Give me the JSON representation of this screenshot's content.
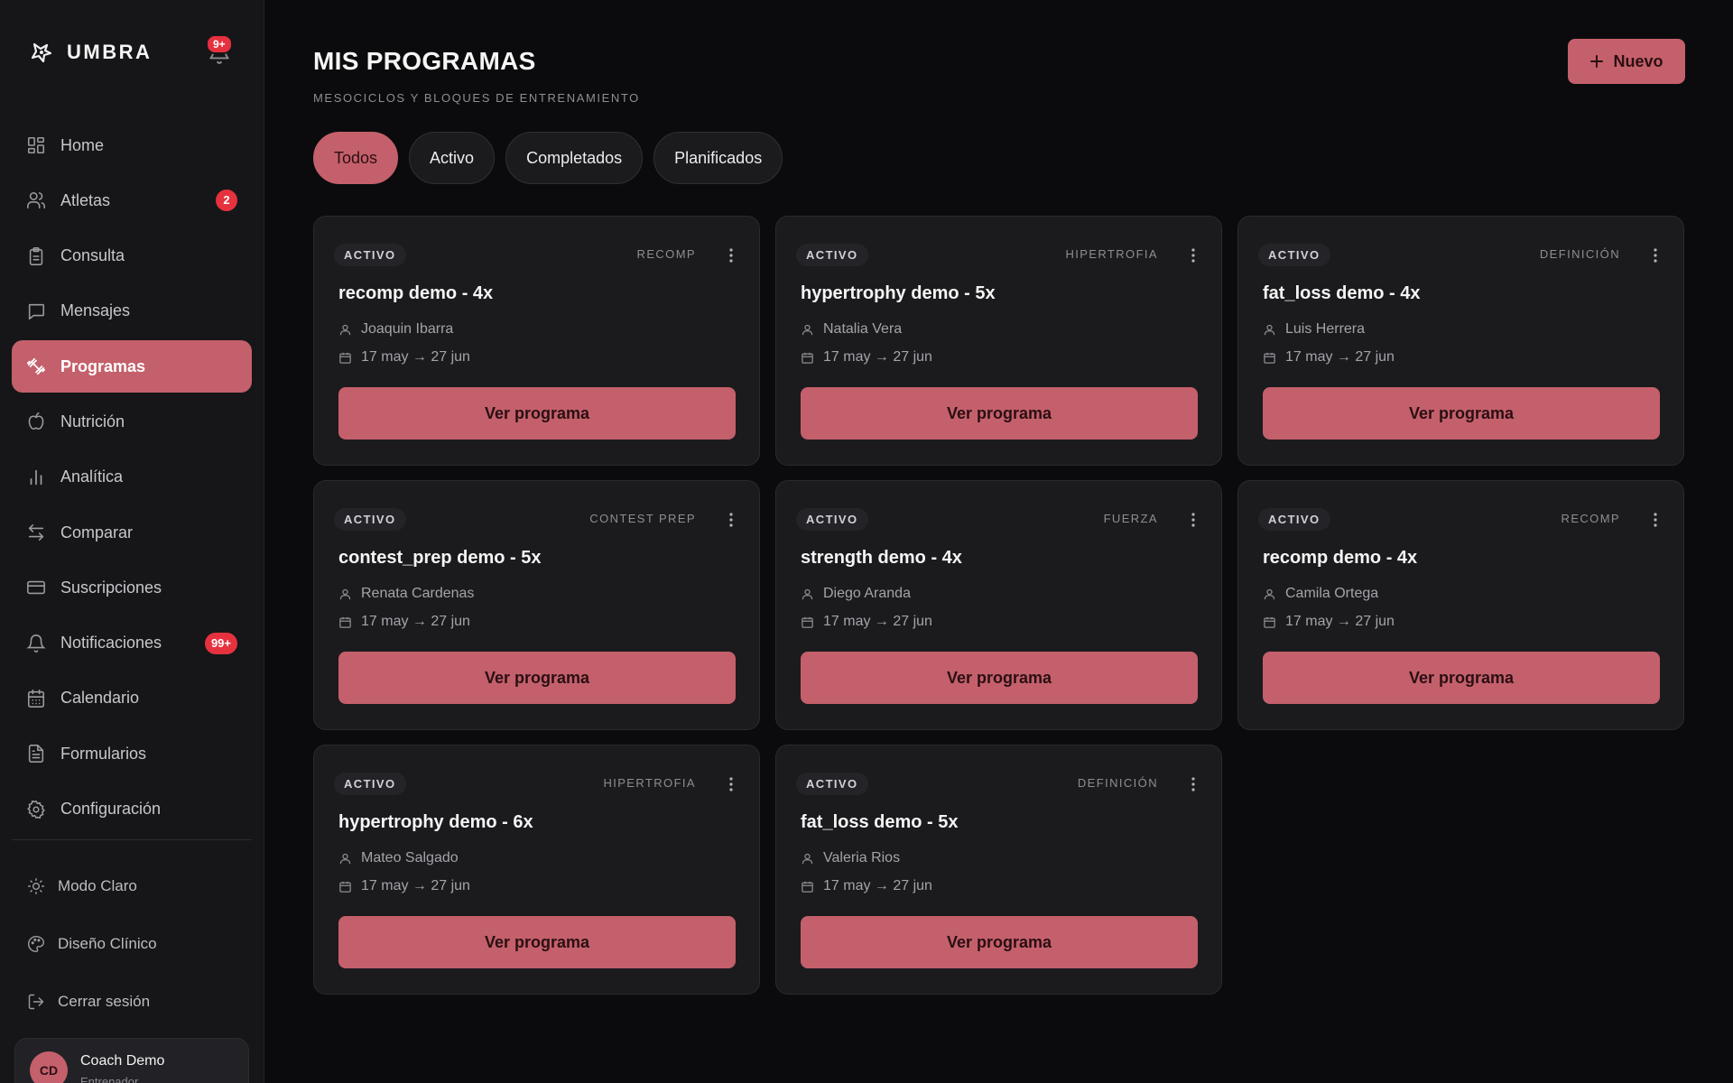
{
  "app": {
    "name": "UMBRA",
    "notifications_badge": "9+"
  },
  "sidebar": {
    "items": [
      {
        "id": "home",
        "label": "Home",
        "icon": "grid-icon",
        "active": false,
        "badge": ""
      },
      {
        "id": "atletas",
        "label": "Atletas",
        "icon": "users-icon",
        "active": false,
        "badge": "2"
      },
      {
        "id": "consulta",
        "label": "Consulta",
        "icon": "clipboard-icon",
        "active": false,
        "badge": ""
      },
      {
        "id": "mensajes",
        "label": "Mensajes",
        "icon": "message-icon",
        "active": false,
        "badge": ""
      },
      {
        "id": "programas",
        "label": "Programas",
        "icon": "dumbbell-icon",
        "active": true,
        "badge": ""
      },
      {
        "id": "nutricion",
        "label": "Nutrición",
        "icon": "apple-icon",
        "active": false,
        "badge": ""
      },
      {
        "id": "analitica",
        "label": "Analítica",
        "icon": "bar-chart-icon",
        "active": false,
        "badge": ""
      },
      {
        "id": "comparar",
        "label": "Comparar",
        "icon": "arrows-swap-icon",
        "active": false,
        "badge": ""
      },
      {
        "id": "suscripciones",
        "label": "Suscripciones",
        "icon": "credit-card-icon",
        "active": false,
        "badge": ""
      },
      {
        "id": "notificaciones",
        "label": "Notificaciones",
        "icon": "bell-icon",
        "active": false,
        "badge": "99+"
      },
      {
        "id": "calendario",
        "label": "Calendario",
        "icon": "calendar-icon",
        "active": false,
        "badge": ""
      },
      {
        "id": "formularios",
        "label": "Formularios",
        "icon": "file-text-icon",
        "active": false,
        "badge": ""
      },
      {
        "id": "configuracion",
        "label": "Configuración",
        "icon": "gear-icon",
        "active": false,
        "badge": ""
      }
    ],
    "bottom": {
      "theme": "Modo Claro",
      "design": "Diseño Clínico",
      "logout": "Cerrar sesión"
    },
    "profile": {
      "initials": "CD",
      "name": "Coach Demo",
      "role": "Entrenador"
    }
  },
  "header": {
    "title": "MIS PROGRAMAS",
    "subtitle": "MESOCICLOS Y BLOQUES DE ENTRENAMIENTO",
    "new_button": "Nuevo"
  },
  "tabs": [
    {
      "label": "Todos",
      "active": true
    },
    {
      "label": "Activo",
      "active": false
    },
    {
      "label": "Completados",
      "active": false
    },
    {
      "label": "Planificados",
      "active": false
    }
  ],
  "programs": [
    {
      "status": "ACTIVO",
      "category": "RECOMP",
      "title": "recomp demo - 4x",
      "athlete": "Joaquin Ibarra",
      "dates": "17 may → 27 jun",
      "button": "Ver programa"
    },
    {
      "status": "ACTIVO",
      "category": "HIPERTROFIA",
      "title": "hypertrophy demo - 5x",
      "athlete": "Natalia Vera",
      "dates": "17 may → 27 jun",
      "button": "Ver programa"
    },
    {
      "status": "ACTIVO",
      "category": "DEFINICIÓN",
      "title": "fat_loss demo - 4x",
      "athlete": "Luis Herrera",
      "dates": "17 may → 27 jun",
      "button": "Ver programa"
    },
    {
      "status": "ACTIVO",
      "category": "CONTEST PREP",
      "title": "contest_prep demo - 5x",
      "athlete": "Renata Cardenas",
      "dates": "17 may → 27 jun",
      "button": "Ver programa"
    },
    {
      "status": "ACTIVO",
      "category": "FUERZA",
      "title": "strength demo - 4x",
      "athlete": "Diego Aranda",
      "dates": "17 may → 27 jun",
      "button": "Ver programa"
    },
    {
      "status": "ACTIVO",
      "category": "RECOMP",
      "title": "recomp demo - 4x",
      "athlete": "Camila Ortega",
      "dates": "17 may → 27 jun",
      "button": "Ver programa"
    },
    {
      "status": "ACTIVO",
      "category": "HIPERTROFIA",
      "title": "hypertrophy demo - 6x",
      "athlete": "Mateo Salgado",
      "dates": "17 may → 27 jun",
      "button": "Ver programa"
    },
    {
      "status": "ACTIVO",
      "category": "DEFINICIÓN",
      "title": "fat_loss demo - 5x",
      "athlete": "Valeria Rios",
      "dates": "17 may → 27 jun",
      "button": "Ver programa"
    }
  ],
  "colors": {
    "accent": "#c4606b",
    "badge": "#e5323e",
    "background": "#0b0b0d",
    "surface": "#1b1b1e"
  }
}
